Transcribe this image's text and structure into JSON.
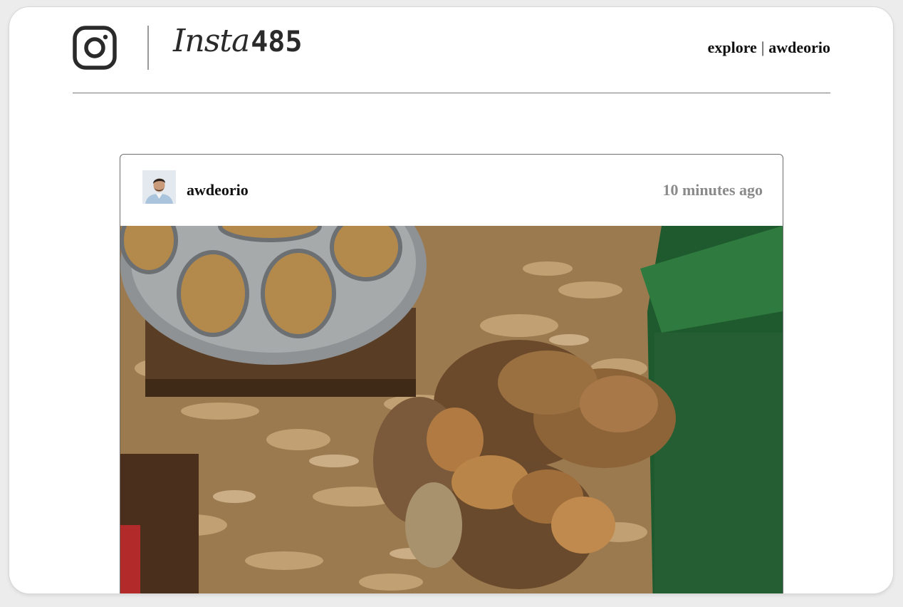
{
  "header": {
    "logo_script": "Insta",
    "logo_number": "485",
    "nav": {
      "explore_label": "explore",
      "separator": "|",
      "user_label": "awdeorio"
    }
  },
  "post": {
    "owner": "awdeorio",
    "timestamp": "10 minutes ago"
  },
  "colors": {
    "text_primary": "#111111",
    "text_muted": "#8a8a8a",
    "border": "#6e6e6e"
  },
  "icons": {
    "logo": "instagram-camera-icon"
  }
}
